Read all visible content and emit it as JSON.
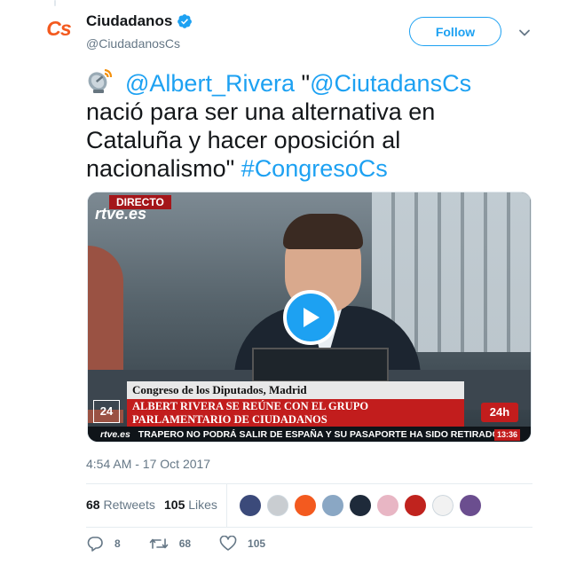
{
  "author": {
    "name": "Ciudadanos",
    "handle": "@CiudadanosCs",
    "avatar_text": "Cs",
    "verified_icon": "verified-badge-icon"
  },
  "follow_label": "Follow",
  "tweet": {
    "emoji_icon": "satellite-antenna-icon",
    "mention1": "@Albert_Rivera",
    "quote_open": " \"",
    "mention2": "@CiutadansCs",
    "body": " nació para ser una alternativa en Cataluña y hacer oposición al nacionalismo\" ",
    "hashtag": "#CongresoCs"
  },
  "video": {
    "live_badge": "DIRECTO",
    "channel_logo": "rtve.es",
    "lower_third_location": "Congreso de los Diputados, Madrid",
    "lower_third_headline": "ALBERT RIVERA SE REÚNE CON EL GRUPO PARLAMENTARIO DE CIUDADANOS",
    "channel_number": "24",
    "channel_brand": "24h",
    "ticker_logo": "rtve.es",
    "ticker_text": "TRAPERO NO PODRÁ SALIR DE ESPAÑA Y SU PASAPORTE HA SIDO RETIRADO",
    "ticker_clock": "13:36",
    "play_icon": "play-icon"
  },
  "timestamp": "4:54 AM - 17 Oct 2017",
  "stats": {
    "retweets_count": "68",
    "retweets_label": "Retweets",
    "likes_count": "105",
    "likes_label": "Likes"
  },
  "likers_colors": [
    "#3b4a7a",
    "#c9cdd1",
    "#f35a1f",
    "#8aa7c4",
    "#1e2a3a",
    "#e8b6c4",
    "#c0231e",
    "#f2f2f2",
    "#6b4e8f"
  ],
  "actions": {
    "reply_count": "8",
    "retweet_count": "68",
    "like_count": "105"
  },
  "colors": {
    "accent": "#1da1f2",
    "brand": "#f35a1f",
    "muted": "#657786"
  }
}
